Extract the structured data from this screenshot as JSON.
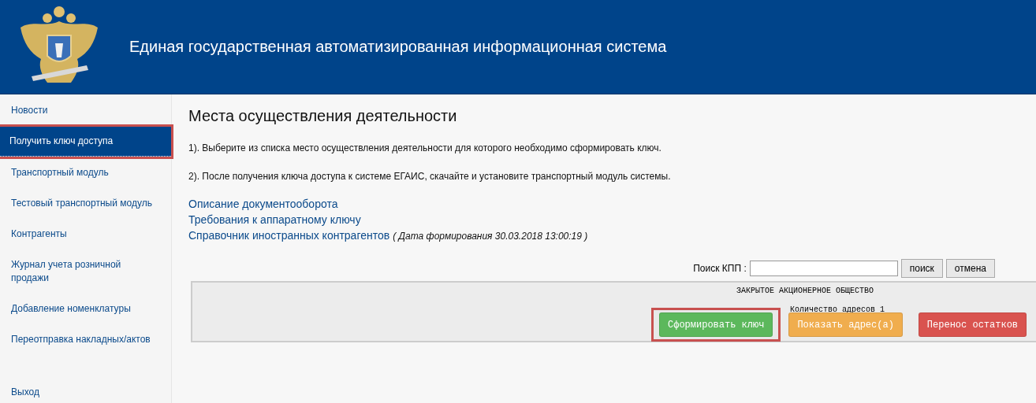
{
  "header": {
    "title": "Единая государственная автоматизированная информационная система"
  },
  "sidebar": {
    "items": [
      {
        "label": "Новости",
        "selected": false,
        "highlighted": false
      },
      {
        "label": "Получить ключ доступа",
        "selected": true,
        "highlighted": true
      },
      {
        "label": "Транспортный модуль",
        "selected": false,
        "highlighted": false
      },
      {
        "label": "Тестовый транспортный модуль",
        "selected": false,
        "highlighted": false
      },
      {
        "label": "Контрагенты",
        "selected": false,
        "highlighted": false
      },
      {
        "label": "Журнал учета розничной продажи",
        "selected": false,
        "highlighted": false
      },
      {
        "label": "Добавление номенклатуры",
        "selected": false,
        "highlighted": false
      },
      {
        "label": "Переотправка накладных/актов",
        "selected": false,
        "highlighted": false
      }
    ],
    "exit": {
      "label": "Выход"
    }
  },
  "main": {
    "title": "Места осуществления деятельности",
    "instructions": [
      "1). Выберите из списка место осуществления деятельности для которого необходимо сформировать ключ.",
      "2). После получения ключа доступа к системе ЕГАИС, скачайте и установите транспортный модуль системы."
    ],
    "links": [
      {
        "label": "Описание документооборота"
      },
      {
        "label": "Требования к аппаратному ключу"
      },
      {
        "label": "Справочник иностранных контрагентов",
        "note": "( Дата формирования 30.03.2018 13:00:19 )"
      }
    ],
    "search": {
      "label": "Поиск КПП :",
      "buttons": [
        "поиск",
        "отмена"
      ]
    },
    "organization": {
      "name": "ЗАКРЫТОЕ АКЦИОНЕРНОЕ ОБЩЕСТВО",
      "address_count": "Количество адресов 1",
      "buttons": [
        {
          "label": "Сформировать ключ",
          "kind": "success",
          "highlighted": true
        },
        {
          "label": "Показать адрес(а)",
          "kind": "warning",
          "highlighted": false
        },
        {
          "label": "Перенос остатков",
          "kind": "danger",
          "highlighted": false
        }
      ]
    }
  }
}
